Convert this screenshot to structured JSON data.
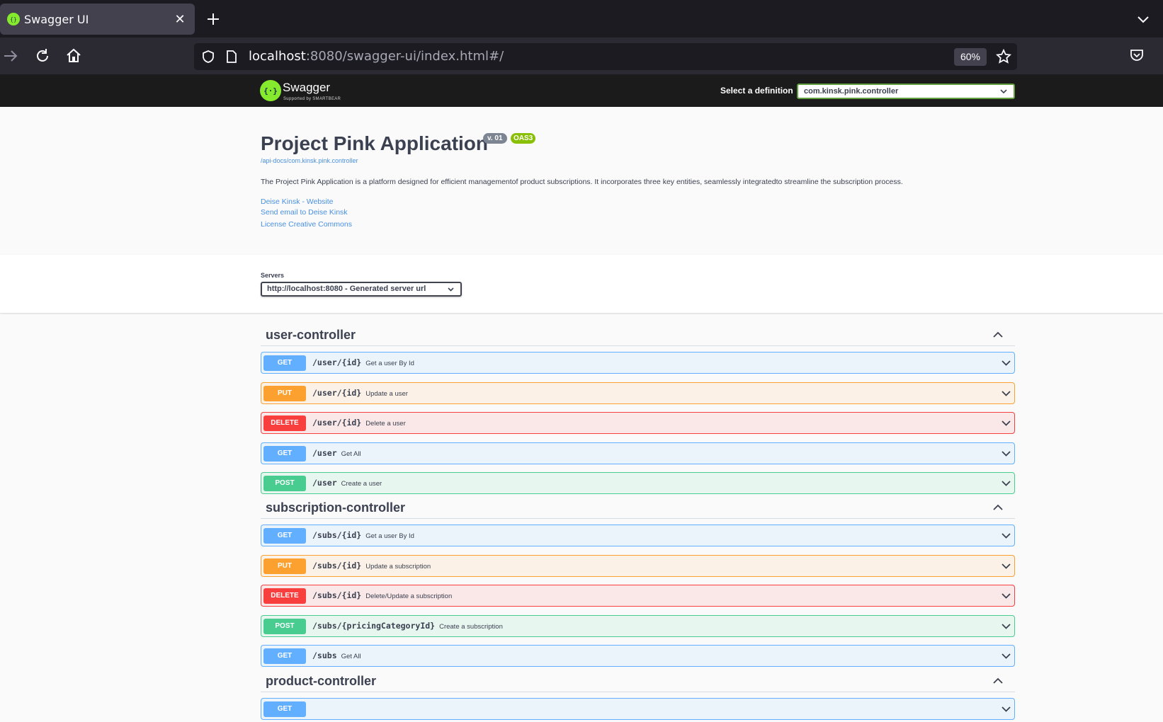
{
  "browser": {
    "tab_title": "Swagger UI",
    "url_host": "localhost",
    "url_rest": ":8080/swagger-ui/index.html#/",
    "zoom": "60%"
  },
  "topbar": {
    "logo_text": "Swagger",
    "logo_sub": "Supported by SMARTBEAR",
    "definition_label": "Select a definition",
    "definition_value": "com.kinsk.pink.controller"
  },
  "info": {
    "title": "Project Pink Application",
    "version": "v. 01",
    "oas": "OAS3",
    "api_url": "/api-docs/com.kinsk.pink.controller",
    "description": "The Project Pink Application is a platform designed for efficient managementof product subscriptions. It incorporates three key entities, seamlessly integratedto streamline the subscription process.",
    "links": [
      "Deise Kinsk - Website",
      "Send email to Deise Kinsk",
      "License Creative Commons"
    ]
  },
  "servers": {
    "label": "Servers",
    "selected": "http://localhost:8080 - Generated server url"
  },
  "tags": [
    {
      "name": "user-controller",
      "operations": [
        {
          "method": "GET",
          "path": "/user/{id}",
          "summary": "Get a user By Id"
        },
        {
          "method": "PUT",
          "path": "/user/{id}",
          "summary": "Update a user"
        },
        {
          "method": "DELETE",
          "path": "/user/{id}",
          "summary": "Delete a user"
        },
        {
          "method": "GET",
          "path": "/user",
          "summary": "Get All"
        },
        {
          "method": "POST",
          "path": "/user",
          "summary": "Create a user"
        }
      ]
    },
    {
      "name": "subscription-controller",
      "operations": [
        {
          "method": "GET",
          "path": "/subs/{id}",
          "summary": "Get a user By Id"
        },
        {
          "method": "PUT",
          "path": "/subs/{id}",
          "summary": "Update a subscription"
        },
        {
          "method": "DELETE",
          "path": "/subs/{id}",
          "summary": "Delete/Update a subscription"
        },
        {
          "method": "POST",
          "path": "/subs/{pricingCategoryId}",
          "summary": "Create a subscription"
        },
        {
          "method": "GET",
          "path": "/subs",
          "summary": "Get All"
        }
      ]
    },
    {
      "name": "product-controller",
      "operations": [
        {
          "method": "GET",
          "path": "",
          "summary": ""
        }
      ]
    }
  ],
  "colors": {
    "get": "#61affe",
    "put": "#fca130",
    "delete": "#f93e3e",
    "post": "#49cc90",
    "swagger_green": "#85ea2d"
  }
}
